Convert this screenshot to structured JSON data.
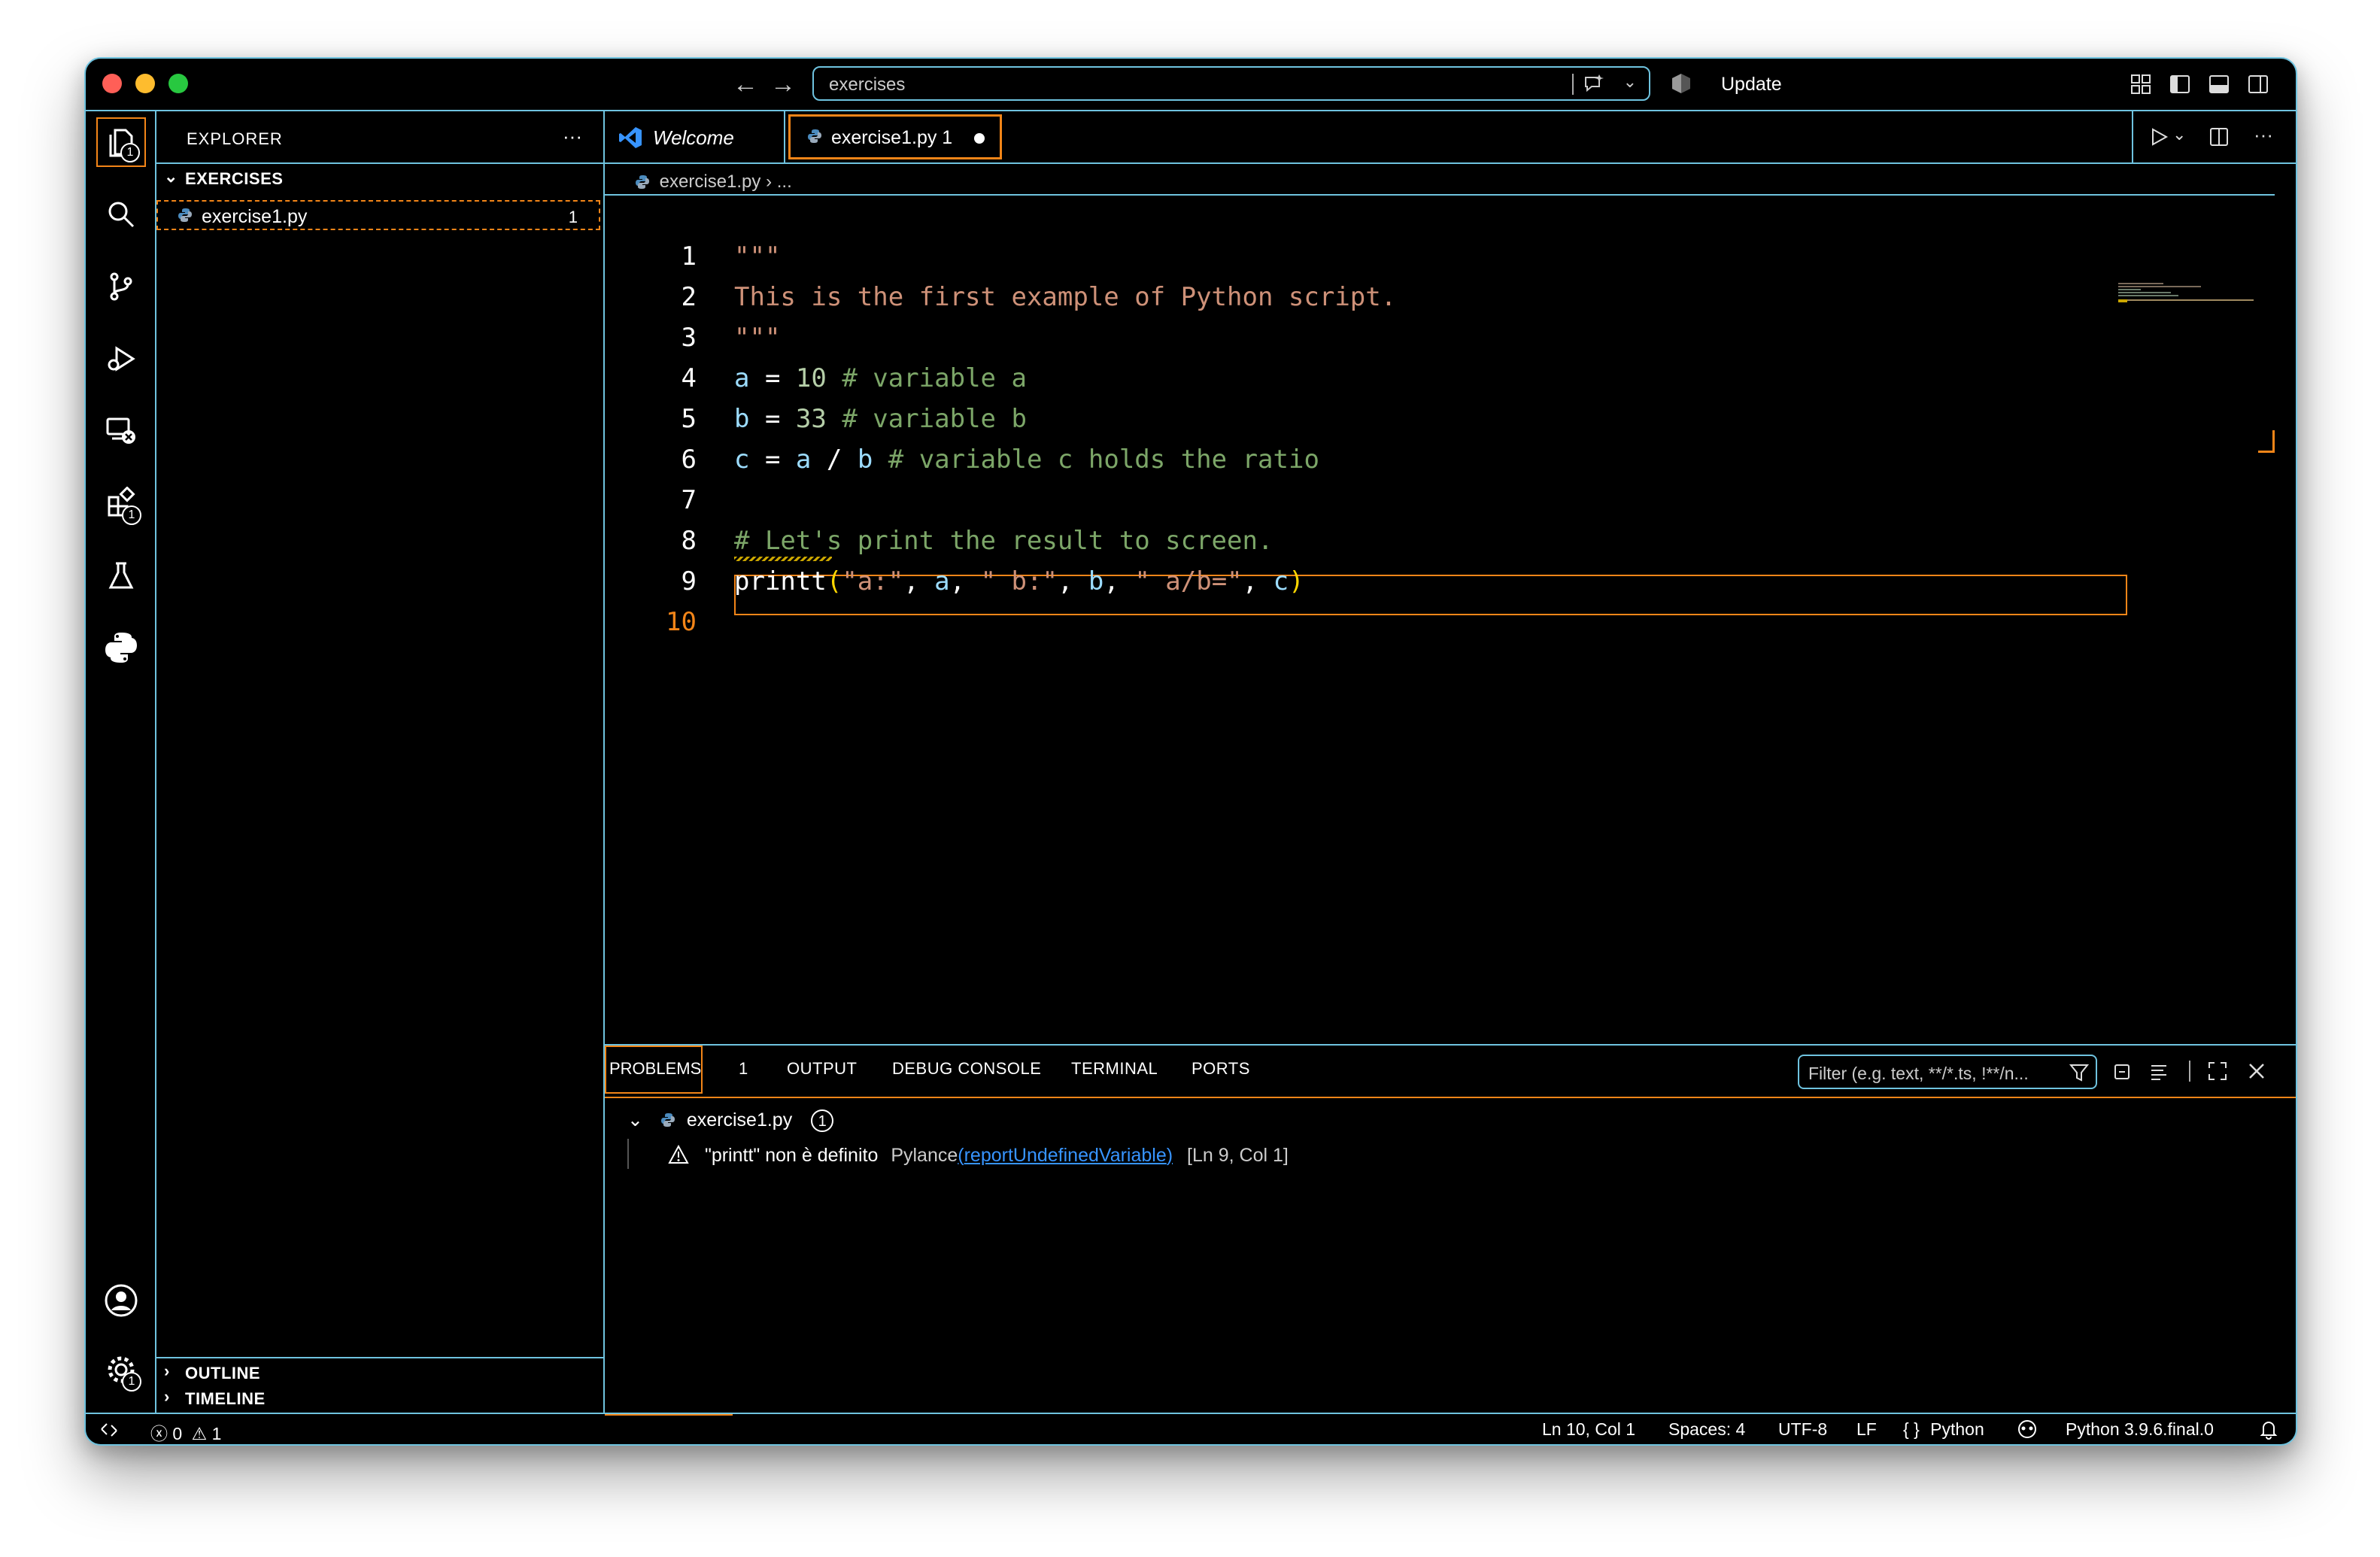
{
  "titlebar": {
    "search_text": "exercises",
    "update_label": "Update"
  },
  "activity_bar": {
    "explorer_badge": "1",
    "extensions_badge": "1",
    "settings_badge": "1"
  },
  "sidebar": {
    "title": "EXPLORER",
    "more": "···",
    "folder": "EXERCISES",
    "files": [
      {
        "name": "exercise1.py",
        "problems": "1"
      }
    ],
    "outline": "OUTLINE",
    "timeline": "TIMELINE"
  },
  "tabs": [
    {
      "label": "Welcome"
    },
    {
      "label": "exercise1.py 1",
      "modified": true
    }
  ],
  "breadcrumb": {
    "file": "exercise1.py",
    "rest": "..."
  },
  "editor": {
    "line_numbers": [
      "1",
      "2",
      "3",
      "4",
      "5",
      "6",
      "7",
      "8",
      "9",
      "10"
    ],
    "current_line": 10
  },
  "panel": {
    "tabs": [
      "PROBLEMS",
      "OUTPUT",
      "DEBUG CONSOLE",
      "TERMINAL",
      "PORTS"
    ],
    "problems_count": "1",
    "filter_placeholder": "Filter (e.g. text, **/*.ts, !**/n...",
    "problem_file": "exercise1.py",
    "problem_file_count": "1",
    "problem": {
      "message": "\"printt\" non è definito",
      "source": "Pylance",
      "code": "reportUndefinedVariable",
      "location": "[Ln 9, Col 1]"
    }
  },
  "statusbar": {
    "errors": "0",
    "warnings": "1",
    "position": "Ln 10, Col 1",
    "spaces": "Spaces: 4",
    "encoding": "UTF-8",
    "eol": "LF",
    "language": "Python",
    "interpreter": "Python 3.9.6.final.0"
  },
  "colors": {
    "border": "#6fc3df",
    "active": "#f38518",
    "background": "#000000",
    "string": "#ce9178",
    "variable": "#9cdcfe",
    "number": "#b5cea8",
    "comment": "#7ca668"
  }
}
